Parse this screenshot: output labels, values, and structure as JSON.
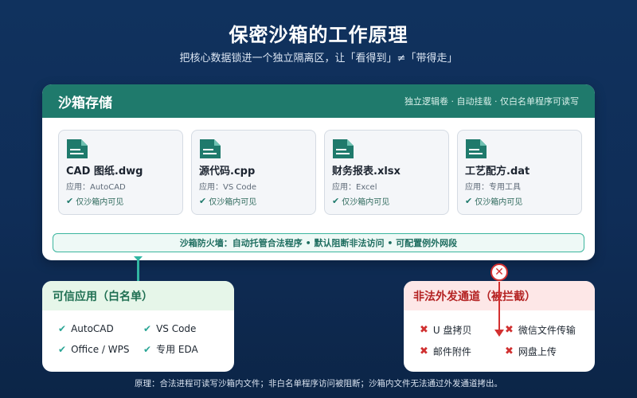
{
  "title": "保密沙箱的工作原理",
  "subtitle": "把核心数据锁进一个独立隔离区，让「看得到」≠「带得走」",
  "sandbox": {
    "title": "沙箱存储",
    "desc": "独立逻辑卷 · 自动挂载 · 仅白名单程序可读写",
    "files": [
      {
        "name": "CAD 图纸.dwg",
        "app": "应用：AutoCAD",
        "scope": "仅沙箱内可见",
        "icon": "document-icon"
      },
      {
        "name": "源代码.cpp",
        "app": "应用：VS Code",
        "scope": "仅沙箱内可见",
        "icon": "document-icon"
      },
      {
        "name": "财务报表.xlsx",
        "app": "应用：Excel",
        "scope": "仅沙箱内可见",
        "icon": "document-icon"
      },
      {
        "name": "工艺配方.dat",
        "app": "应用：专用工具",
        "scope": "仅沙箱内可见",
        "icon": "document-icon"
      }
    ],
    "firewall": "沙箱防火墙：自动托管合法程序 • 默认阻断非法访问 • 可配置例外网段"
  },
  "whitelist": {
    "title": "可信应用（白名单）",
    "items": [
      "AutoCAD",
      "VS Code",
      "Office / WPS",
      "专用 EDA"
    ]
  },
  "blocked": {
    "title": "非法外发通道（被拦截）",
    "items": [
      "U 盘拷贝",
      "微信文件传输",
      "邮件附件",
      "网盘上传"
    ]
  },
  "footer": "原理：合法进程可读写沙箱内文件；非白名单程序访问被阻断；沙箱内文件无法通过外发通道拷出。",
  "colors": {
    "background": "#10325e",
    "sandbox_header": "#1f7a6c",
    "whitelist_accent": "#2aa595",
    "blocked_accent": "#d03030"
  }
}
